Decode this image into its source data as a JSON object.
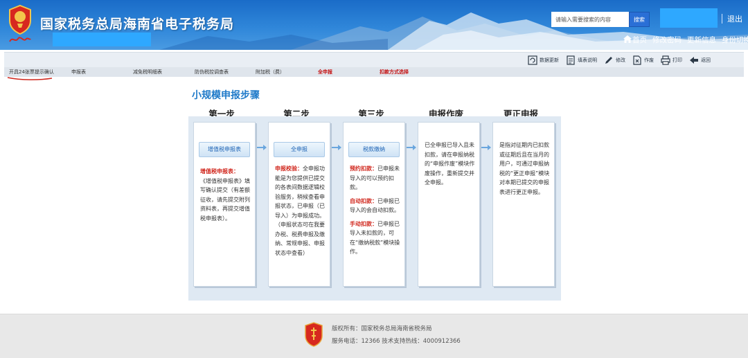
{
  "header": {
    "title": "国家税务总局海南省电子税务局",
    "search_placeholder": "请输入需要搜索的内容",
    "search_label": "搜索",
    "logout": "退出",
    "links": [
      "首页",
      "修改密码",
      "更新信息",
      "身份切换"
    ]
  },
  "toolbar": {
    "tools": [
      {
        "label": "数据更新",
        "icon": "refresh-icon"
      },
      {
        "label": "填表说明",
        "icon": "document-icon"
      },
      {
        "label": "修改",
        "icon": "pencil-icon"
      },
      {
        "label": "作废",
        "icon": "void-icon"
      },
      {
        "label": "打印",
        "icon": "printer-icon"
      },
      {
        "label": "返回",
        "icon": "back-arrow-icon"
      }
    ]
  },
  "tabs": [
    {
      "label": "开具24张票提示确认"
    },
    {
      "label": "申报表"
    },
    {
      "label": "减免税明细表"
    },
    {
      "label": "防伪税控调查表"
    },
    {
      "label": "附加税（费）"
    },
    {
      "label": "全申报",
      "highlight": true
    },
    {
      "label": "扣款方式选择",
      "highlight": true
    }
  ],
  "main": {
    "title": "小规模申报步骤",
    "steps": [
      {
        "heading": "第一步",
        "button": "增值税申报表",
        "lines": [
          {
            "t": "增值税申报表：",
            "red": true
          },
          {
            "t": "《增值税申报表》填写确认提交（有差额征收，请先提交附列资料表，再提交增值税申报表）。",
            "red": false
          }
        ]
      },
      {
        "heading": "第二步",
        "button": "全申报",
        "lines": [
          {
            "t": "申报校验：",
            "red": true
          },
          {
            "t": "全申报功能是为您提供已提交的各表间数据逻辑校验服务，稍候查看申报状态，已申报（已导入）为申报成功。（申报状态可在我要办税、税费申报及缴纳、常规申报、申报状态中查看）",
            "red": false
          }
        ]
      },
      {
        "heading": "第三步",
        "button": "税款缴纳",
        "lines": [
          {
            "t": "预约扣款：",
            "red": true
          },
          {
            "t": "已申报未导入的可以预约扣款。",
            "red": false
          },
          {
            "t": "自动扣款：",
            "red": true
          },
          {
            "t": "已申报已导入的会自动扣款。",
            "red": false
          },
          {
            "t": "手动扣款：",
            "red": true
          },
          {
            "t": "已申报已导入未扣款的，可在“缴纳税款”模块操作。",
            "red": false
          }
        ]
      },
      {
        "heading": "申报作废",
        "button": "",
        "lines": [
          {
            "t": "已全申报已导入且未扣款，请在申报纳税的“申报作废”模块作废操作，重新提交并全申报。",
            "red": false
          }
        ]
      },
      {
        "heading": "更正申报",
        "button": "",
        "lines": [
          {
            "t": "是指对征期内已扣款或征期后且在当月的用户，可通过申报纳税的“更正申报”模块对本期已提交的申报表进行更正申报。",
            "red": false
          }
        ]
      }
    ]
  },
  "footer": {
    "copyright": "版权所有：国家税务总局海南省税务局",
    "phone": "服务电话：12366 技术支持热线：4000912366"
  },
  "colors": {
    "header_blue": "#2f86d9",
    "accent_red": "#d0261c",
    "title_blue": "#1f7ac9"
  }
}
